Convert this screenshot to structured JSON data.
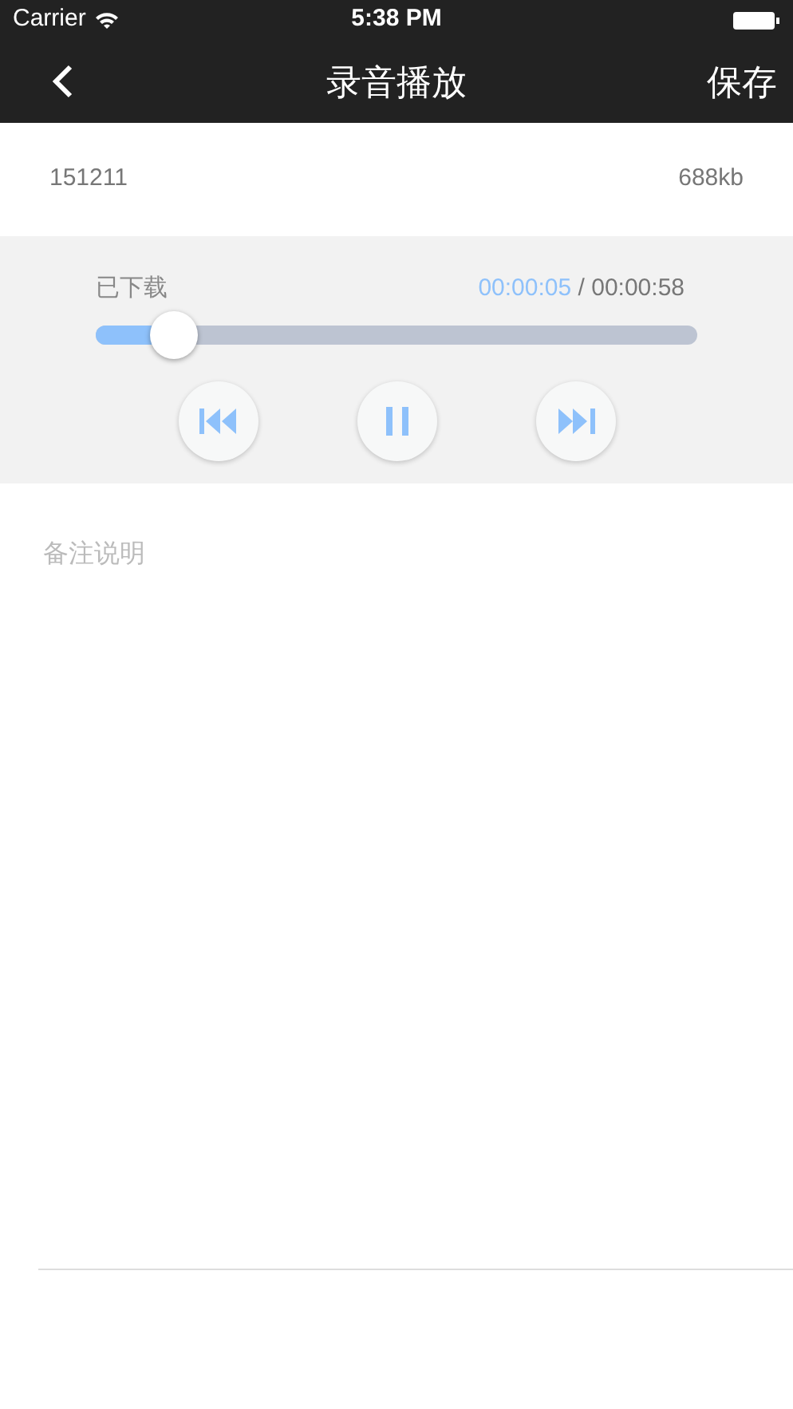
{
  "status_bar": {
    "carrier": "Carrier",
    "time": "5:38 PM"
  },
  "nav": {
    "title": "录音播放",
    "action": "保存"
  },
  "file": {
    "name": "151211",
    "size": "688kb"
  },
  "player": {
    "status": "已下载",
    "elapsed": "00:00:05",
    "separator": "/",
    "total": "00:00:58",
    "level": 0.13,
    "playing": true
  },
  "note": {
    "placeholder": "备注说明"
  }
}
